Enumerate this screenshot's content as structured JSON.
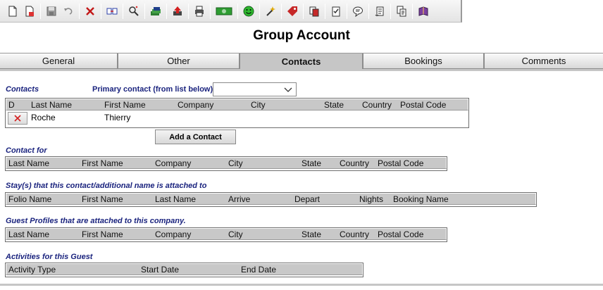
{
  "toolbar": {
    "icons": [
      "new-icon",
      "new-page-icon",
      "save-icon",
      "undo-icon",
      "delete-icon",
      "transfer-icon",
      "find-icon",
      "money-stack-icon",
      "upload-icon",
      "print-icon",
      "cash-icon",
      "smile-icon",
      "wand-icon",
      "tag-icon",
      "copy-icon",
      "checklist-icon",
      "chat-icon",
      "scroll-icon",
      "pages-icon",
      "book-icon"
    ]
  },
  "title": "Group Account",
  "tabs": [
    {
      "label": "General"
    },
    {
      "label": "Other"
    },
    {
      "label": "Contacts",
      "active": true
    },
    {
      "label": "Bookings"
    },
    {
      "label": "Comments"
    }
  ],
  "contacts": {
    "section_label": "Contacts",
    "primary_label": "Primary contact (from list below)",
    "primary_value": "",
    "columns": [
      "D",
      "Last Name",
      "First Name",
      "Company",
      "City",
      "State",
      "Country",
      "Postal Code"
    ],
    "rows": [
      {
        "last_name": "Roche",
        "first_name": "Thierry"
      }
    ],
    "add_button": "Add a Contact"
  },
  "contact_for": {
    "section_label": "Contact for",
    "columns": [
      "Last Name",
      "First Name",
      "Company",
      "City",
      "State",
      "Country",
      "Postal Code"
    ]
  },
  "stays": {
    "section_label": "Stay(s) that this contact/additional name is attached to",
    "columns": [
      "Folio Name",
      "First Name",
      "Last Name",
      "Arrive",
      "Depart",
      "Nights",
      "Booking Name"
    ]
  },
  "guest_profiles": {
    "section_label": "Guest Profiles that are attached to this company.",
    "columns": [
      "Last Name",
      "First Name",
      "Company",
      "City",
      "State",
      "Country",
      "Postal Code"
    ]
  },
  "activities": {
    "section_label": "Activities for this Guest",
    "columns": [
      "Activity Type",
      "Start Date",
      "End Date"
    ]
  },
  "colors": {
    "section_label": "#1a237e",
    "tab_active": "#c6c6c6",
    "grid_header": "#c8c8c8",
    "delete_red": "#d32020"
  }
}
